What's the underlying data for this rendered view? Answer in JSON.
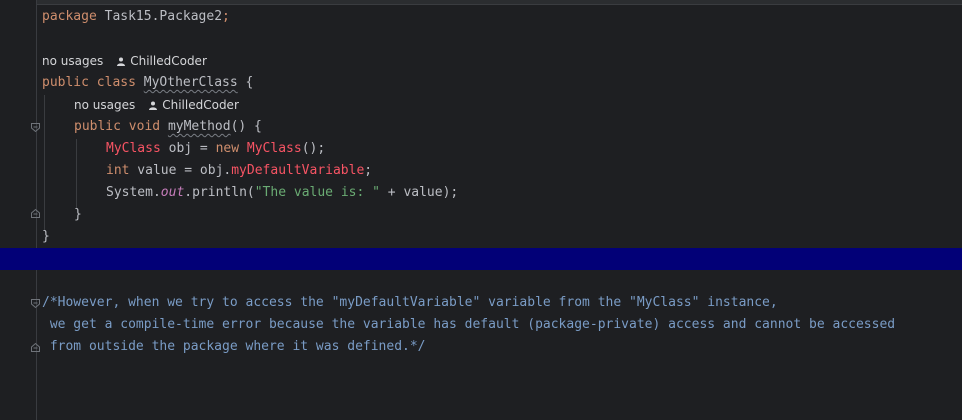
{
  "editor": {
    "package_line": {
      "keyword": "package",
      "name": " Task15.Package2",
      "semicolon": ";"
    },
    "class_usages_hint": "no usages",
    "class_author_hint": "ChilledCoder",
    "class_decl": {
      "kw_public": "public",
      "kw_class": "class",
      "class_name": "MyOtherClass",
      "brace": " {"
    },
    "method_usages_hint": "no usages",
    "method_author_hint": "ChilledCoder",
    "method_decl": {
      "kw_public": "public",
      "kw_void": "void",
      "method_name": "myMethod",
      "rest": "() {"
    },
    "line_obj": {
      "type": "MyClass",
      "var": " obj = ",
      "kw_new": "new",
      "ctor": " MyClass",
      "end": "();"
    },
    "line_value": {
      "type": "int",
      "prefix": " value = obj.",
      "field": "myDefaultVariable",
      "end": ";"
    },
    "line_print": {
      "prefix": "System.",
      "out": "out",
      "call": ".println(",
      "string": "\"The value is: \"",
      "end": " + value);"
    },
    "close_method": "}",
    "close_class": "}",
    "comment_lines": [
      "/*However, when we try to access the \"myDefaultVariable\" variable from the \"MyClass\" instance,",
      " we get a compile-time error because the variable has default (package-private) access and cannot be accessed",
      " from outside the package where it was defined.*/"
    ]
  },
  "colors": {
    "background": "#1e1f22",
    "keyword": "#cf8e6d",
    "error": "#f75464",
    "field": "#c77dbb",
    "string": "#6aab73",
    "comment": "#7a9cc6",
    "highlight_line": "#020077"
  },
  "icons": {
    "author": "user-icon",
    "fold": "fold-marker-icon"
  }
}
